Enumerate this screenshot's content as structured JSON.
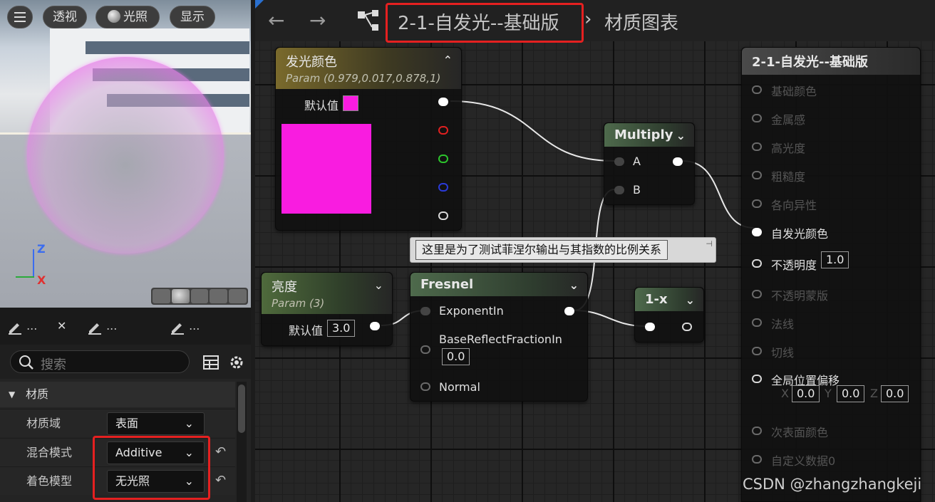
{
  "viewport": {
    "menu_icon": "hamburger-icon",
    "perspective_label": "透视",
    "lighting_label": "光照",
    "show_label": "显示",
    "axis_z": "Z",
    "axis_x": "X"
  },
  "details": {
    "tabs": [
      {
        "label": "...",
        "close": "✕"
      },
      {
        "label": "..."
      },
      {
        "label": "..."
      }
    ],
    "search_placeholder": "搜索",
    "category": "材质",
    "properties": [
      {
        "label": "材质域",
        "value": "表面"
      },
      {
        "label": "混合模式",
        "value": "Additive"
      },
      {
        "label": "着色模型",
        "value": "无光照"
      }
    ]
  },
  "toolbar": {
    "back": "←",
    "forward": "→",
    "material_name": "2-1-自发光--基础版",
    "separator": "›",
    "graph_label": "材质图表"
  },
  "nodes": {
    "emissive_param": {
      "title": "发光颜色",
      "subtitle": "Param (0.979,0.017,0.878,1)",
      "default_label": "默认值",
      "color": "#f91ce0"
    },
    "multiply": {
      "title": "Multiply",
      "pin_a": "A",
      "pin_b": "B"
    },
    "brightness_param": {
      "title": "亮度",
      "subtitle": "Param (3)",
      "default_label": "默认值",
      "default_value": "3.0"
    },
    "fresnel": {
      "title": "Fresnel",
      "pin_exponent": "ExponentIn",
      "pin_base": "BaseReflectFractionIn",
      "base_value": "0.0",
      "pin_normal": "Normal"
    },
    "one_minus": {
      "title": "1-x"
    },
    "comment": "这里是为了测试菲涅尔输出与其指数的比例关系",
    "result": {
      "title": "2-1-自发光--基础版",
      "pins": [
        "基础颜色",
        "金属感",
        "高光度",
        "粗糙度",
        "各向异性",
        "自发光颜色",
        "不透明度",
        "不透明蒙版",
        "法线",
        "切线",
        "全局位置偏移",
        "次表面颜色",
        "自定义数据0"
      ],
      "opacity_value": "1.0",
      "wpo_x_label": "X",
      "wpo_x": "0.0",
      "wpo_y_label": "Y",
      "wpo_y": "0.0",
      "wpo_z_label": "Z",
      "wpo_z": "0.0"
    }
  },
  "watermark": "CSDN @zhangzhangkeji"
}
